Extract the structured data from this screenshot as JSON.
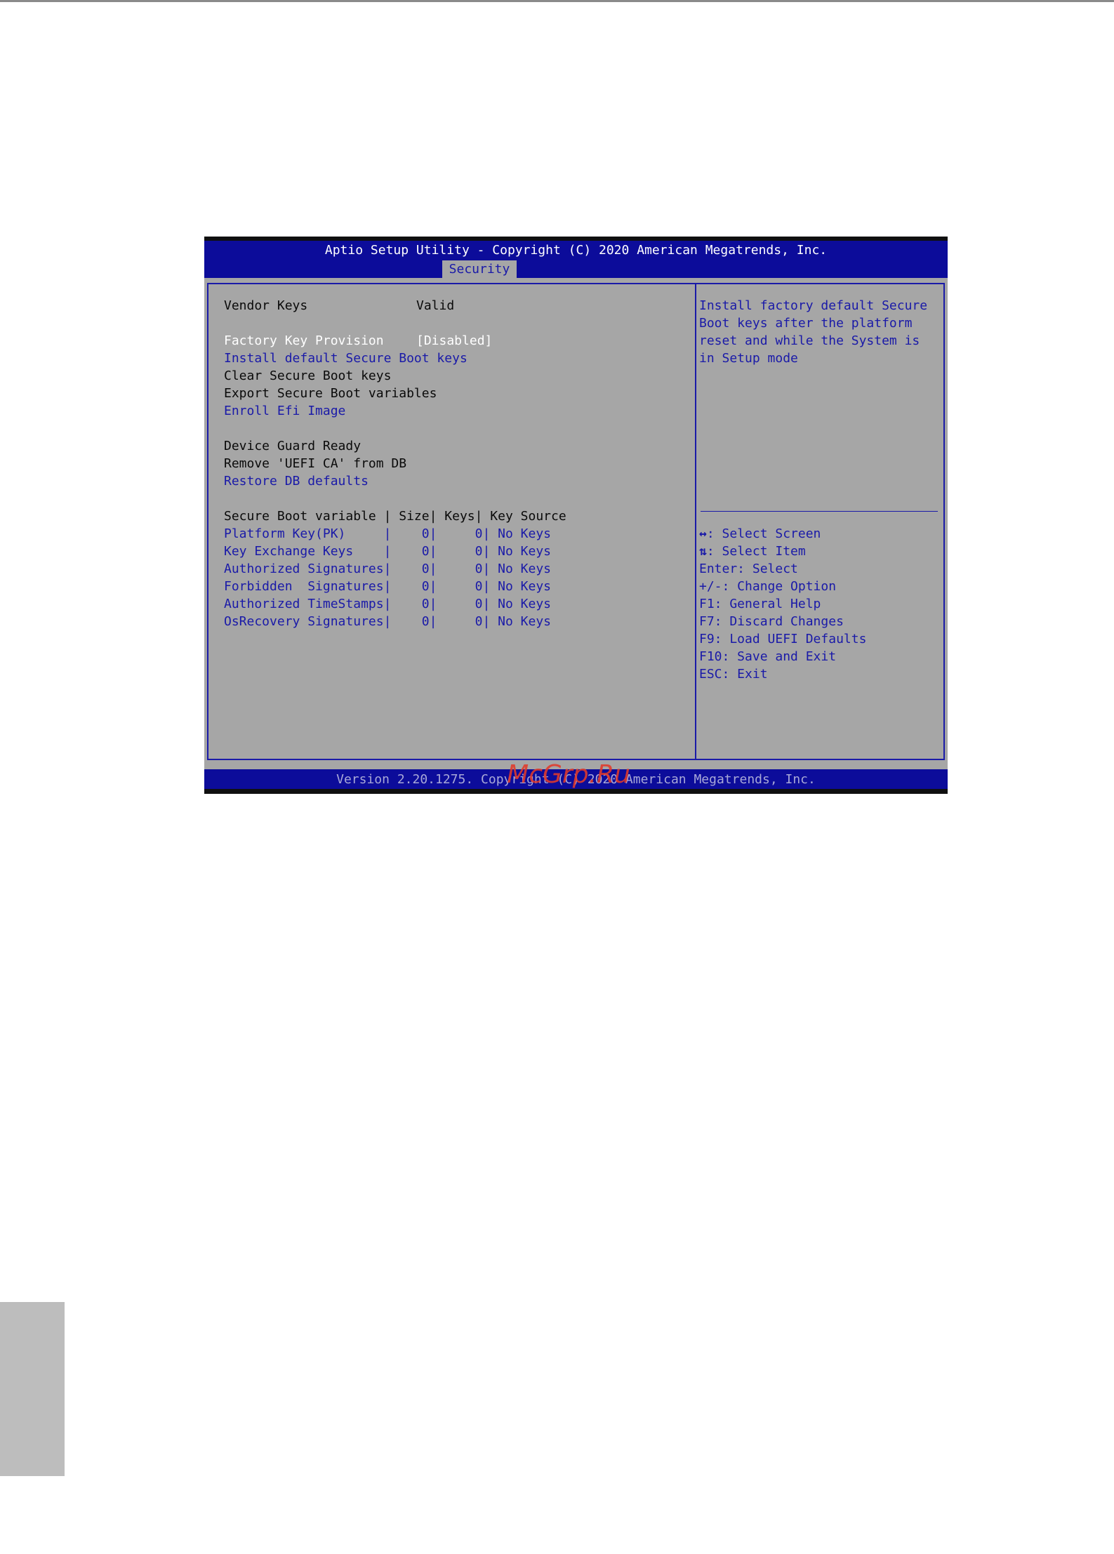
{
  "bios": {
    "header_title": "Aptio Setup Utility - Copyright (C) 2020 American Megatrends, Inc.",
    "active_tab": "Security",
    "footer": "Version 2.20.1275. Copyright (C) 2020 American Megatrends, Inc.",
    "colors": {
      "blue": "#0c0c9a",
      "grey": "#a6a6a6",
      "link": "#1a1aa8",
      "white": "#ffffff"
    }
  },
  "main": {
    "vendor_keys": {
      "label": "Vendor Keys",
      "value": "Valid"
    },
    "factory_key_provision": {
      "label": "Factory Key Provision",
      "value": "[Disabled]"
    },
    "install_default": "Install default Secure Boot keys",
    "clear_keys": "Clear Secure Boot keys",
    "export_vars": "Export Secure Boot variables",
    "enroll_efi": "Enroll Efi Image",
    "device_guard": "Device Guard Ready",
    "remove_uefi_ca": "Remove 'UEFI CA' from DB",
    "restore_db": "Restore DB defaults",
    "table_header": "Secure Boot variable | Size| Keys| Key Source",
    "table_rows": [
      "Platform Key(PK)     |    0|     0| No Keys",
      "Key Exchange Keys    |    0|     0| No Keys",
      "Authorized Signatures|    0|     0| No Keys",
      "Forbidden  Signatures|    0|     0| No Keys",
      "Authorized TimeStamps|    0|     0| No Keys",
      "OsRecovery Signatures|    0|     0| No Keys"
    ]
  },
  "help": {
    "lines": [
      "Install factory default Secure",
      "Boot keys after the platform",
      "reset and while the System is",
      "in Setup mode"
    ],
    "keys": [
      {
        "sym": "↔",
        "text": ": Select Screen"
      },
      {
        "sym": "⇅",
        "text": ": Select Item"
      },
      {
        "sym": "",
        "text": "Enter: Select"
      },
      {
        "sym": "",
        "text": "+/-: Change Option"
      },
      {
        "sym": "",
        "text": "F1: General Help"
      },
      {
        "sym": "",
        "text": "F7: Discard Changes"
      },
      {
        "sym": "",
        "text": "F9: Load UEFI Defaults"
      },
      {
        "sym": "",
        "text": "F10: Save and Exit"
      },
      {
        "sym": "",
        "text": "ESC: Exit"
      }
    ]
  },
  "watermark": "McGrp.Ru"
}
